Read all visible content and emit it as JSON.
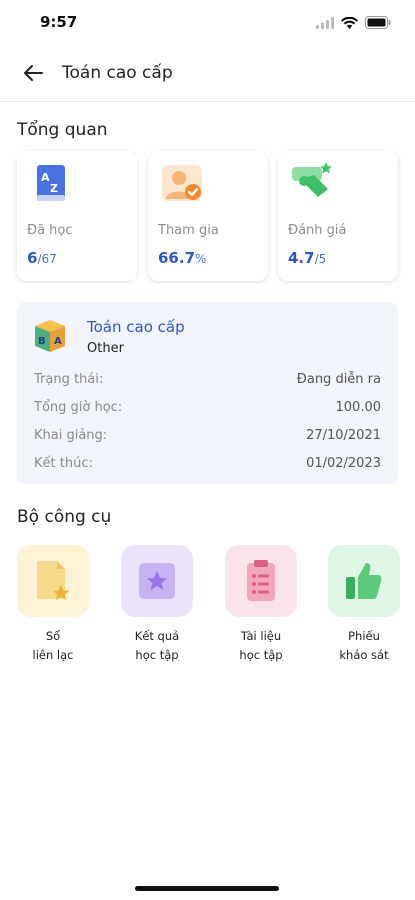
{
  "status_bar": {
    "time": "9:57"
  },
  "header": {
    "title": "Toán cao cấp"
  },
  "overview": {
    "title": "Tổng quan",
    "stats": [
      {
        "icon": "az-book-icon",
        "label": "Đã học",
        "value": "6",
        "suffix": "/67"
      },
      {
        "icon": "participant-check-icon",
        "label": "Tham gia",
        "value": "66.7",
        "suffix": "%"
      },
      {
        "icon": "rating-hand-star-icon",
        "label": "Đánh giá",
        "value": "4.7",
        "suffix": "/5"
      }
    ]
  },
  "course": {
    "name": "Toán cao cấp",
    "category": "Other",
    "rows": [
      {
        "label": "Trạng thái:",
        "value": "Đang diễn ra"
      },
      {
        "label": "Tổng giờ học:",
        "value": "100.00"
      },
      {
        "label": "Khai giảng:",
        "value": "27/10/2021"
      },
      {
        "label": "Kết thúc:",
        "value": "01/02/2023"
      }
    ]
  },
  "toolkit": {
    "title": "Bộ công cụ",
    "items": [
      {
        "icon": "contact-book-icon",
        "label": "Sổ\nliên lạc",
        "color": "#fdf1d6"
      },
      {
        "icon": "learning-results-icon",
        "label": "Kết quả\nhọc tập",
        "color": "#ece3fb"
      },
      {
        "icon": "learning-materials-icon",
        "label": "Tài liệu\nhọc tập",
        "color": "#fbe3ea"
      },
      {
        "icon": "survey-thumbs-up-icon",
        "label": "Phiếu\nkhảo sát",
        "color": "#dff6e6"
      }
    ]
  },
  "colors": {
    "accent": "#2d56c8",
    "card_bg": "#f2f4fb"
  }
}
